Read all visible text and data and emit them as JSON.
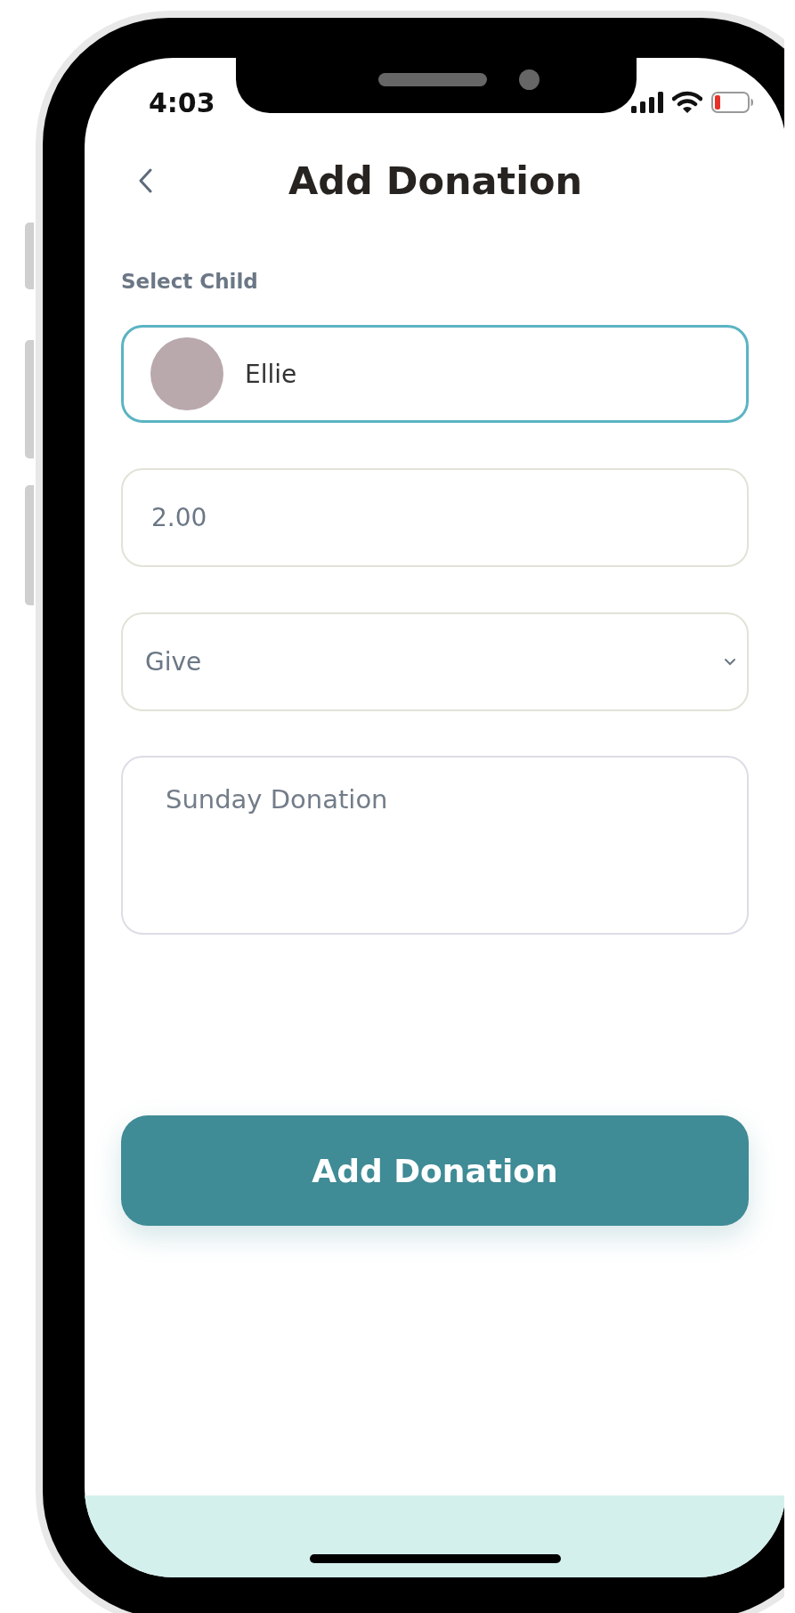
{
  "status_bar": {
    "time": "4:03"
  },
  "header": {
    "title": "Add Donation"
  },
  "form": {
    "child_label": "Select Child",
    "child": {
      "name": "Ellie",
      "focused": true
    },
    "amount": {
      "value": "2.00"
    },
    "type_select": {
      "value": "Give"
    },
    "note": {
      "value": "Sunday Donation"
    }
  },
  "submit_button": {
    "label": "Add Donation"
  }
}
